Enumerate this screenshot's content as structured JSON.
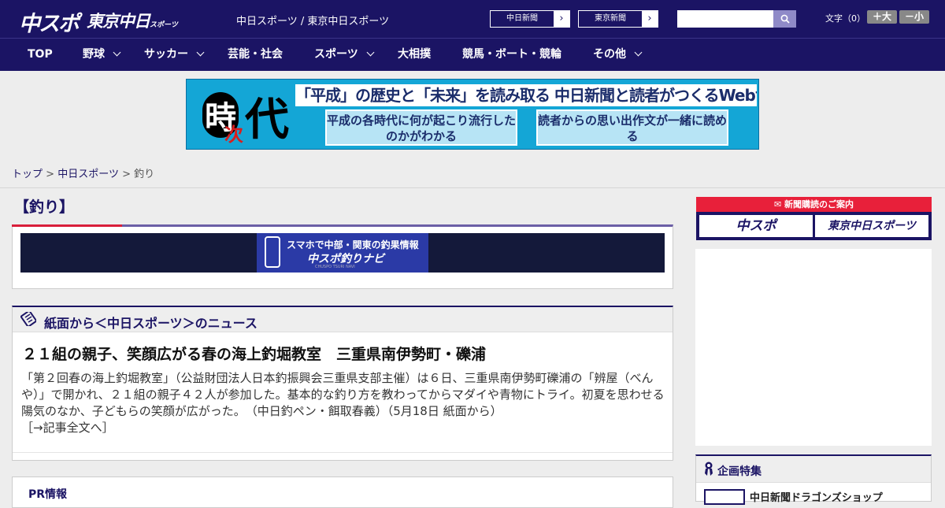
{
  "header": {
    "logo_chuspo": "中スポ",
    "logo_tokyo": "東京中日",
    "logo_tokyo_small": "スポーツ",
    "site_names": "中日スポーツ / 東京中日スポーツ",
    "paper_links": [
      {
        "label": "中日新聞",
        "arrow": "›"
      },
      {
        "label": "東京新聞",
        "arrow": "›"
      }
    ],
    "search": {
      "placeholder": "",
      "icon": "search-icon"
    },
    "font_size_label": "文字（0）",
    "font_plus": "＋大",
    "font_minus": "－小"
  },
  "nav": {
    "items": [
      {
        "label": "TOP",
        "dropdown": false
      },
      {
        "label": "野球",
        "dropdown": true
      },
      {
        "label": "サッカー",
        "dropdown": true
      },
      {
        "label": "芸能・社会",
        "dropdown": false
      },
      {
        "label": "スポーツ",
        "dropdown": true
      },
      {
        "label": "大相撲",
        "dropdown": false
      },
      {
        "label": "競馬・ボート・競輪",
        "dropdown": false
      },
      {
        "label": "その他",
        "dropdown": true
      }
    ]
  },
  "banner": {
    "kanji": [
      "時",
      "次",
      "代"
    ],
    "headline": "「平成」の歴史と「未来」を読み取る 中日新聞と読者がつくるWebサイト",
    "sub_left": "平成の各時代に何が起こり流行したのかがわかる",
    "sub_right": "読者からの思い出作文が一緒に読める"
  },
  "breadcrumb": {
    "items": [
      "トップ",
      "中日スポーツ"
    ],
    "separator": ">",
    "current": "釣り"
  },
  "page_title": "【釣り】",
  "navi_banner": {
    "line1": "スマホで中部・関東の釣果情報",
    "line2": "中スポ釣りナビ",
    "line3": "CHUSPO TSURI NAVI"
  },
  "news_section": {
    "header": "紙面から＜中日スポーツ＞のニュース",
    "article": {
      "title": "２１組の親子、笑顔広がる春の海上釣堀教室　三重県南伊勢町・礫浦",
      "body": "「第２回春の海上釣堀教室」（公益財団法人日本釣振興会三重県支部主催）は６日、三重県南伊勢町礫浦の「辨屋（べんや）」で開かれ、２１組の親子４２人が参加した。基本的な釣り方を教わってからマダイや青物にトライ。初夏を思わせる陽気のなか、子どもらの笑顔が広がった。　（中日釣ペン・餌取春義）（5月18日 紙面から）",
      "more_link": "［→記事全文へ］"
    }
  },
  "pr_section": {
    "header": "PR情報"
  },
  "sidebar": {
    "subscribe_title": "新聞購読のご案内",
    "subscribe_left": "中スポ",
    "subscribe_right": "東京中日スポーツ",
    "kikaku_header": "企画特集",
    "kikaku_item": "中日新聞ドラゴンズショップ"
  },
  "colors": {
    "brand_navy": "#1b1464",
    "accent_red": "#e8203a",
    "background": "#ededed"
  }
}
